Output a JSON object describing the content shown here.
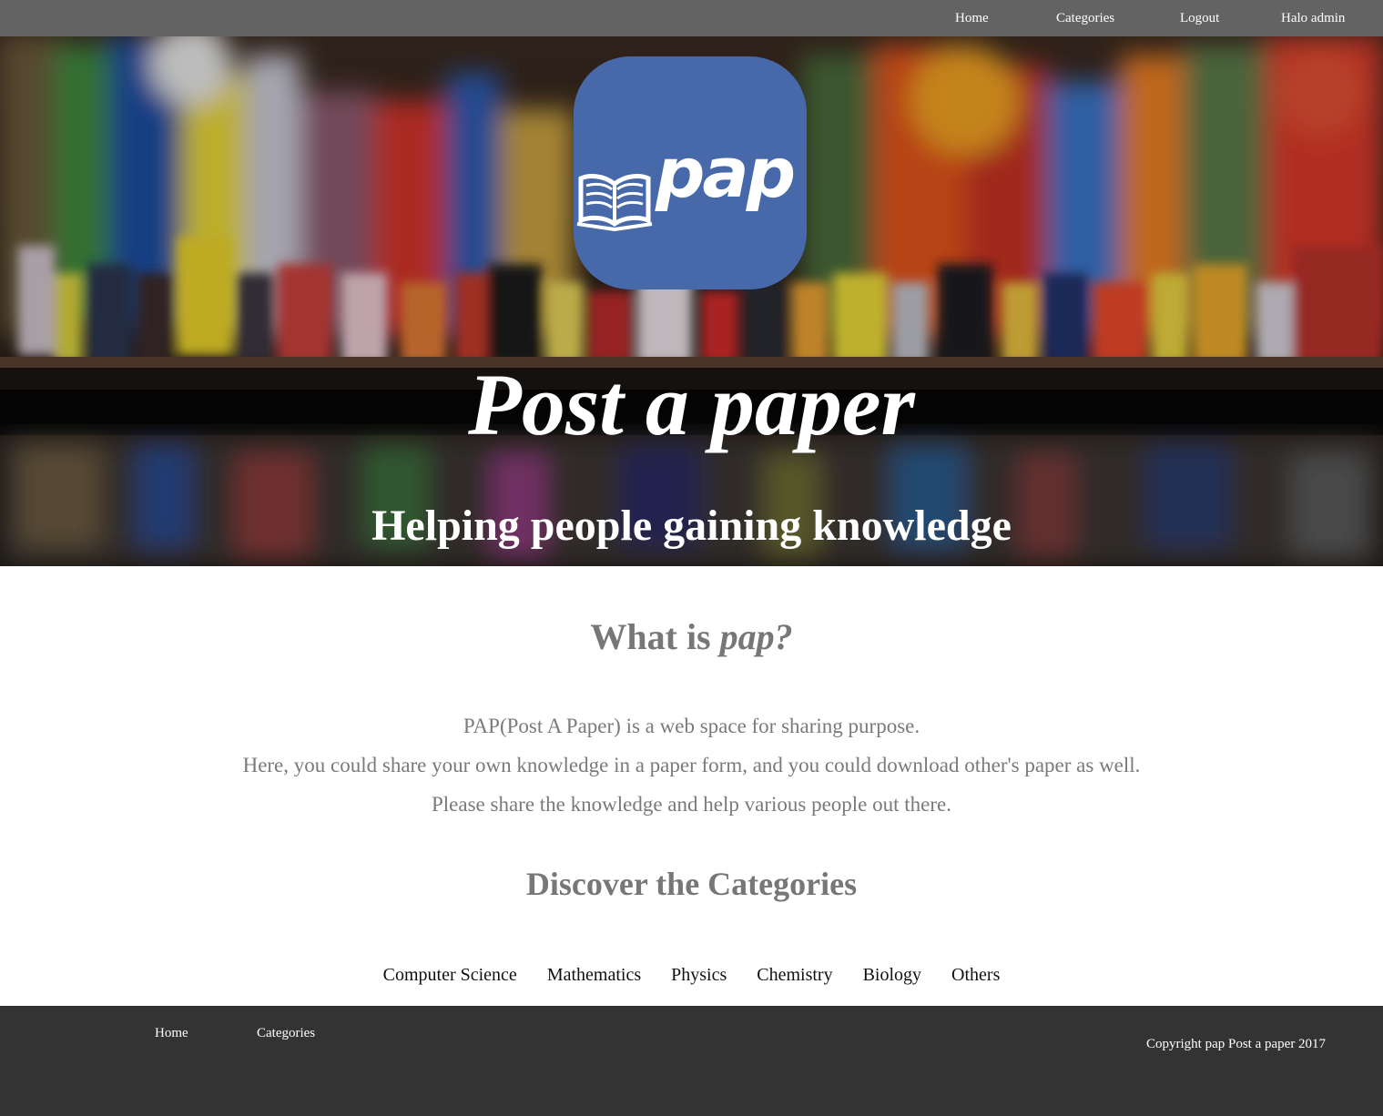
{
  "topnav": {
    "links": [
      "Home",
      "Categories",
      "Logout",
      "Halo admin"
    ]
  },
  "hero": {
    "logo_text": "pap",
    "logo_color": "#4769a9",
    "title": "Post a paper",
    "subtitle": "Helping people gaining knowledge"
  },
  "about": {
    "heading_prefix": "What is ",
    "heading_brand": "pap?",
    "lines": [
      "PAP(Post A Paper) is a web space for sharing purpose.",
      "Here, you could share your own knowledge in a paper form, and you could download other's paper as well.",
      "Please share the knowledge and help various people out there."
    ]
  },
  "categories": {
    "heading": "Discover the Categories",
    "items": [
      "Computer Science",
      "Mathematics",
      "Physics",
      "Chemistry",
      "Biology",
      "Others"
    ]
  },
  "footer": {
    "links": [
      "Home",
      "Categories"
    ],
    "copyright": "Copyright pap Post a paper 2017"
  }
}
